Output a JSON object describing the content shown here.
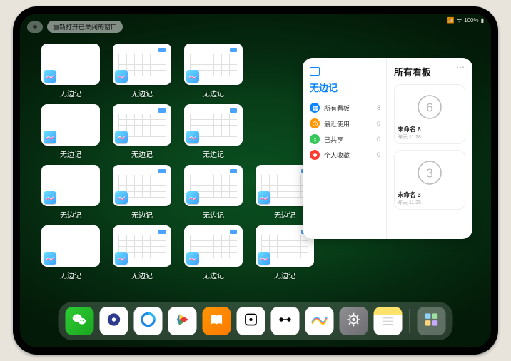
{
  "statusbar": {
    "signal": "📶",
    "wifi": "ᯤ",
    "battery_pct": "100%",
    "battery_icon": "▮"
  },
  "navbar": {
    "plus": "+",
    "reopen_label": "重新打开已关闭的窗口"
  },
  "tile_label": "无边记",
  "tiles": [
    {
      "variant": "blank"
    },
    {
      "variant": "cal"
    },
    {
      "variant": "cal"
    },
    {
      "variant": "blank"
    },
    {
      "variant": "cal"
    },
    {
      "variant": "cal"
    },
    {
      "variant": "blank"
    },
    {
      "variant": "cal"
    },
    {
      "variant": "cal"
    },
    {
      "variant": "cal"
    },
    {
      "variant": "blank"
    },
    {
      "variant": "cal"
    },
    {
      "variant": "cal"
    },
    {
      "variant": "cal"
    }
  ],
  "grid_rows": [
    3,
    3,
    4,
    4
  ],
  "panel": {
    "left_title": "无边记",
    "right_title": "所有看板",
    "ellipsis": "⋯",
    "items": [
      {
        "icon": "grid",
        "color": "#0a84ff",
        "label": "所有看板",
        "count": 8
      },
      {
        "icon": "clock",
        "color": "#ff9500",
        "label": "最近使用",
        "count": 0
      },
      {
        "icon": "share",
        "color": "#34c759",
        "label": "已共享",
        "count": 0
      },
      {
        "icon": "heart",
        "color": "#ff3b30",
        "label": "个人收藏",
        "count": 0
      }
    ],
    "cards": [
      {
        "digit": "6",
        "name": "未命名 6",
        "sub": "昨天 11:28"
      },
      {
        "digit": "3",
        "name": "未命名 3",
        "sub": "昨天 11:25"
      }
    ]
  },
  "dock": {
    "apps": [
      {
        "name": "wechat",
        "bg": "linear-gradient(135deg,#2dcd33,#1aa51f)"
      },
      {
        "name": "browser-1",
        "bg": "#fff"
      },
      {
        "name": "browser-2",
        "bg": "#fff"
      },
      {
        "name": "play",
        "bg": "#fff"
      },
      {
        "name": "books",
        "bg": "linear-gradient(135deg,#ff9500,#ff7a00)"
      },
      {
        "name": "dice",
        "bg": "#fff"
      },
      {
        "name": "dots",
        "bg": "#fff"
      },
      {
        "name": "freeform",
        "bg": "#fff"
      },
      {
        "name": "settings",
        "bg": "linear-gradient(135deg,#8e8e93,#6d6d72)"
      },
      {
        "name": "notes",
        "bg": "linear-gradient(180deg,#ffe26c 0 28%,#fff 28%)"
      }
    ],
    "recent": {
      "name": "app-library",
      "bg": "rgba(255,255,255,.25)"
    }
  }
}
